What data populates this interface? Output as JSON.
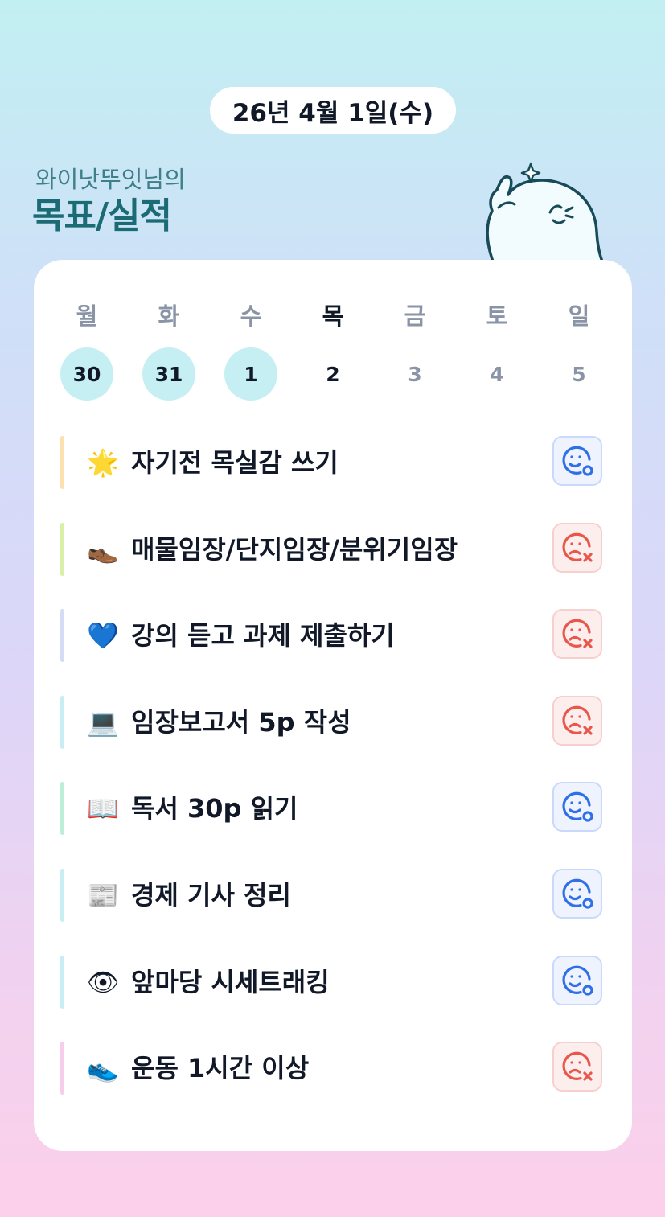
{
  "header": {
    "date": "26년 4월 1일(수)",
    "owner": "와이낫뚜잇님의",
    "title": "목표/실적"
  },
  "week": {
    "weekdays": [
      "월",
      "화",
      "수",
      "목",
      "금",
      "토",
      "일"
    ],
    "days": [
      "30",
      "31",
      "1",
      "2",
      "3",
      "4",
      "5"
    ],
    "completed_days": [
      "30",
      "31",
      "1"
    ],
    "today_index": 3
  },
  "goals": [
    {
      "emoji": "🌟",
      "icon": "glowing-star-icon",
      "label": "자기전 목실감 쓰기",
      "status": "success",
      "color": "#fde0b0"
    },
    {
      "emoji": "👞",
      "icon": "shoe-icon",
      "label": "매물임장/단지임장/분위기임장",
      "status": "fail",
      "color": "#d8f0a8"
    },
    {
      "emoji": "💙",
      "icon": "blue-heart-icon",
      "label": "강의 듣고 과제 제출하기",
      "status": "fail",
      "color": "#d4dcf6"
    },
    {
      "emoji": "💻",
      "icon": "laptop-icon",
      "label": "임장보고서 5p 작성",
      "status": "fail",
      "color": "#c8eef4"
    },
    {
      "emoji": "📖",
      "icon": "open-book-icon",
      "label": "독서 30p 읽기",
      "status": "success",
      "color": "#bdeed8"
    },
    {
      "emoji": "📰",
      "icon": "newspaper-icon",
      "label": "경제 기사 정리",
      "status": "success",
      "color": "#c8eef4"
    },
    {
      "emoji": "👁",
      "icon": "eye-icon",
      "label": "앞마당 시세트래킹",
      "status": "success",
      "color": "#c8eef4"
    },
    {
      "emoji": "👟",
      "icon": "sneaker-icon",
      "label": "운동 1시간 이상",
      "status": "fail",
      "color": "#f6cdea"
    }
  ],
  "colors": {
    "success": "#2f6fe8",
    "fail": "#e8574a",
    "title": "#1a6b73",
    "completed_day": "#c5eff2"
  }
}
